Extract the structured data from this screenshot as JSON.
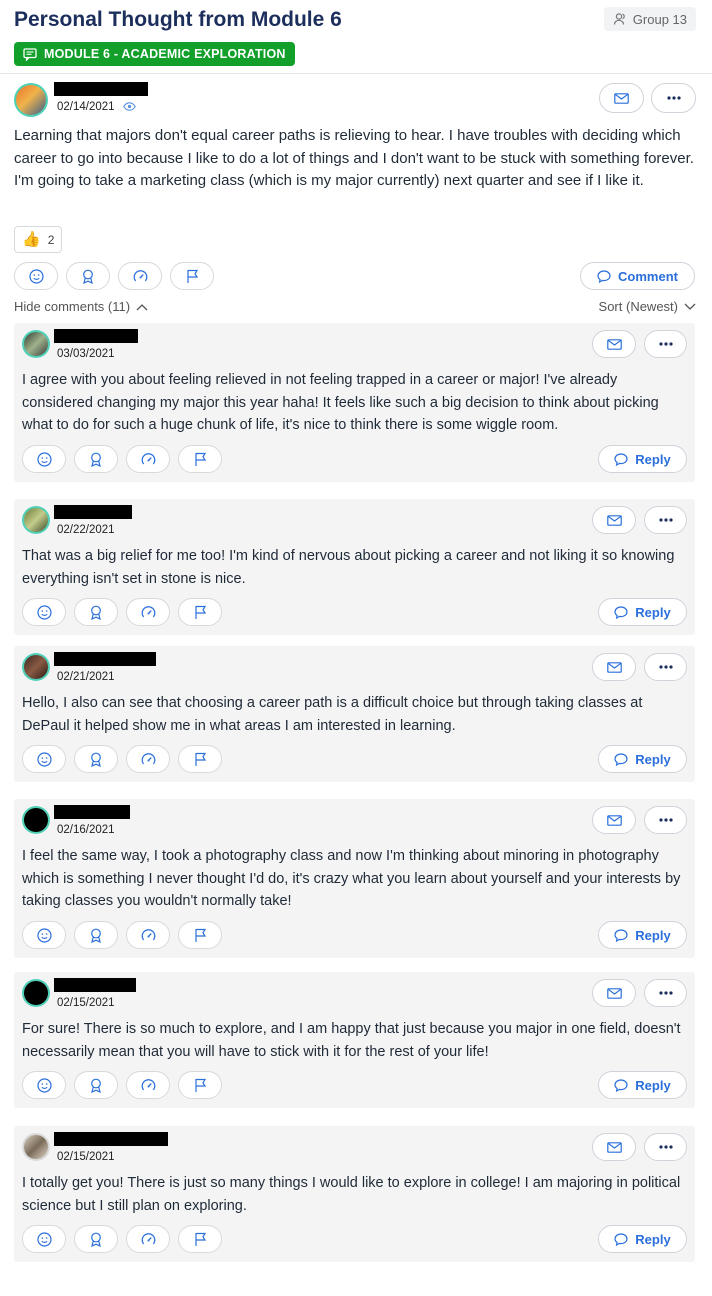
{
  "header": {
    "title": "Personal Thought from Module 6",
    "group_label": "Group 13",
    "module_badge": "MODULE 6 - ACADEMIC EXPLORATION"
  },
  "post": {
    "date": "02/14/2021",
    "text": "Learning that majors don't equal career paths is relieving to hear. I have troubles with deciding which career to go into because I like to do a lot of things and I don't want to be stuck with something forever. I'm going to take a marketing class (which is my major currently) next quarter and see if I like it.",
    "like_count": "2",
    "comment_label": "Comment",
    "hide_comments_label": "Hide comments (11)",
    "sort_label": "Sort (Newest)"
  },
  "comments": [
    {
      "date": "03/03/2021",
      "text": "I agree with you about feeling relieved in not feeling trapped in a career or major! I've already considered changing my major this year haha! It feels like such a big decision to think about picking what to do for such a huge chunk of life, it's nice to think there is some wiggle room.",
      "reply_label": "Reply"
    },
    {
      "date": "02/22/2021",
      "text": "That was a big relief for me too! I'm kind of nervous about picking a career and not liking it so knowing everything isn't set in stone is nice.",
      "reply_label": "Reply"
    },
    {
      "date": "02/21/2021",
      "text": "Hello, I also can see that choosing a career path is a difficult choice but through taking classes at DePaul it helped show me in what areas I am interested in learning.",
      "reply_label": "Reply"
    },
    {
      "date": "02/16/2021",
      "text": "I feel the same way, I took a photography class and now I'm thinking about minoring in photography which is something I never thought I'd do, it's crazy what you learn about yourself and your interests by taking classes you wouldn't normally take!",
      "reply_label": "Reply"
    },
    {
      "date": "02/15/2021",
      "text": "For sure! There is so much to explore, and I am happy that just because you major in one field, doesn't necessarily mean that you will have to stick with it for the rest of your life!",
      "reply_label": "Reply"
    },
    {
      "date": "02/15/2021",
      "text": "I totally get you! There is just so many things I would like to explore in college! I am majoring in political science but I still plan on exploring.",
      "reply_label": "Reply"
    }
  ],
  "icons": {
    "group": "group-icon",
    "module": "chat-square-icon",
    "views": "eye-icon",
    "message": "envelope-icon",
    "more": "ellipsis-icon",
    "like": "thumbs-up-icon",
    "smile": "smile-icon",
    "award": "award-icon",
    "gauge": "gauge-icon",
    "flag": "flag-icon",
    "comment": "speech-bubble-icon",
    "chevron_up": "chevron-up-icon",
    "chevron_down": "chevron-down-icon"
  },
  "colors": {
    "title": "#1c2f5c",
    "badge": "#12a02b",
    "accent": "#2a6fdb",
    "comment_bg": "#f4f4f5"
  }
}
